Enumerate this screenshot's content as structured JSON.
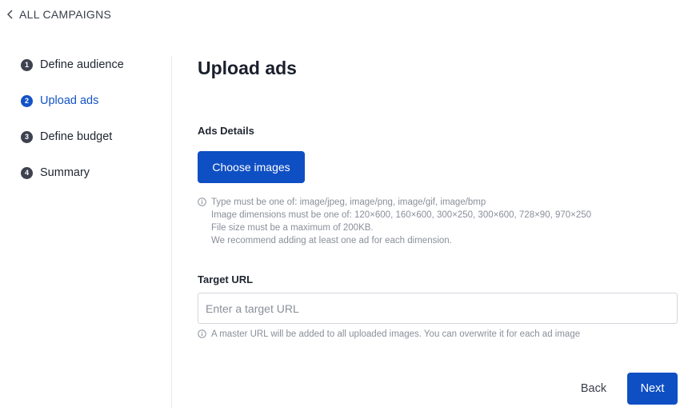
{
  "nav": {
    "back_label": "ALL CAMPAIGNS",
    "back_icon": "chevron-left-icon"
  },
  "steps": [
    {
      "number": "1",
      "label": "Define audience",
      "active": false
    },
    {
      "number": "2",
      "label": "Upload ads",
      "active": true
    },
    {
      "number": "3",
      "label": "Define budget",
      "active": false
    },
    {
      "number": "4",
      "label": "Summary",
      "active": false
    }
  ],
  "main": {
    "title": "Upload ads",
    "ads_details": {
      "label": "Ads Details",
      "button_label": "Choose images",
      "hint_icon": "info-icon",
      "hint_lines": [
        "Type must be one of: image/jpeg, image/png, image/gif, image/bmp",
        "Image dimensions must be one of: 120×600, 160×600, 300×250, 300×600, 728×90, 970×250",
        "File size must be a maximum of 200KB.",
        "We recommend adding at least one ad for each dimension."
      ]
    },
    "target_url": {
      "label": "Target URL",
      "value": "",
      "placeholder": "Enter a target URL",
      "hint_icon": "info-icon",
      "hint": "A master URL will be added to all uploaded images. You can overwrite it for each ad image"
    }
  },
  "footer": {
    "back_label": "Back",
    "next_label": "Next"
  },
  "colors": {
    "primary": "#0f4fc4",
    "active_step": "#1453c5",
    "step_inactive": "#3d4150",
    "hint_text": "#8a8f99"
  }
}
